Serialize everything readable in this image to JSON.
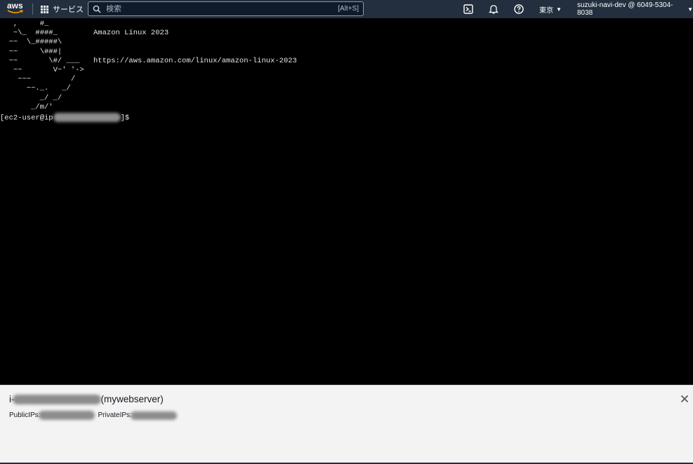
{
  "nav": {
    "logo_text": "aws",
    "services_label": "サービス",
    "search_placeholder": "検索",
    "search_shortcut": "[Alt+S]",
    "region_label": "東京",
    "account_label": "suzuki-navi-dev @ 6049-5304-8038"
  },
  "terminal": {
    "ascii_art": "   ,     #_\n   ~\\_  ####_\n  ~~  \\_#####\\\n  ~~     \\###|\n  ~~       \\#/ ___\n   ~~       V~' '->\n    ~~~         /\n      ~~._.   _/\n         _/ _/\n       _/m/'",
    "line_product": "Amazon Linux 2023",
    "line_url": "https://aws.amazon.com/linux/amazon-linux-2023",
    "prompt_prefix": "[ec2-user@ip",
    "prompt_suffix": "]$"
  },
  "panel": {
    "instance_prefix": "i-",
    "instance_name": "(mywebserver)",
    "public_ips_label": "PublicIPs:",
    "private_ips_label": "PrivateIPs:"
  }
}
